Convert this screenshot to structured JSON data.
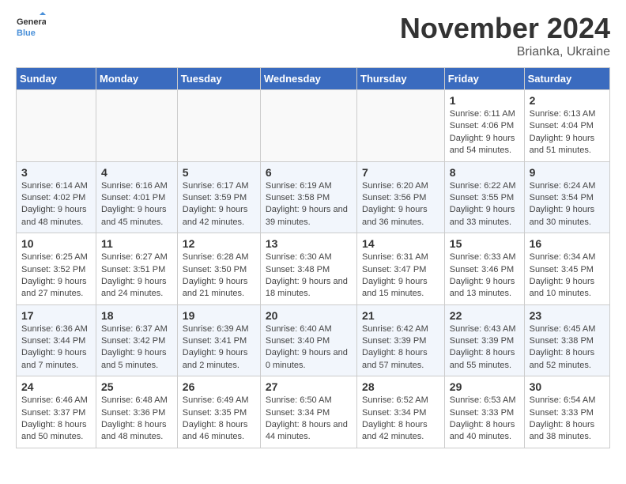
{
  "header": {
    "logo_line1": "General",
    "logo_line2": "Blue",
    "month": "November 2024",
    "location": "Brianka, Ukraine"
  },
  "weekdays": [
    "Sunday",
    "Monday",
    "Tuesday",
    "Wednesday",
    "Thursday",
    "Friday",
    "Saturday"
  ],
  "weeks": [
    [
      {
        "day": "",
        "info": ""
      },
      {
        "day": "",
        "info": ""
      },
      {
        "day": "",
        "info": ""
      },
      {
        "day": "",
        "info": ""
      },
      {
        "day": "",
        "info": ""
      },
      {
        "day": "1",
        "info": "Sunrise: 6:11 AM\nSunset: 4:06 PM\nDaylight: 9 hours and 54 minutes."
      },
      {
        "day": "2",
        "info": "Sunrise: 6:13 AM\nSunset: 4:04 PM\nDaylight: 9 hours and 51 minutes."
      }
    ],
    [
      {
        "day": "3",
        "info": "Sunrise: 6:14 AM\nSunset: 4:02 PM\nDaylight: 9 hours and 48 minutes."
      },
      {
        "day": "4",
        "info": "Sunrise: 6:16 AM\nSunset: 4:01 PM\nDaylight: 9 hours and 45 minutes."
      },
      {
        "day": "5",
        "info": "Sunrise: 6:17 AM\nSunset: 3:59 PM\nDaylight: 9 hours and 42 minutes."
      },
      {
        "day": "6",
        "info": "Sunrise: 6:19 AM\nSunset: 3:58 PM\nDaylight: 9 hours and 39 minutes."
      },
      {
        "day": "7",
        "info": "Sunrise: 6:20 AM\nSunset: 3:56 PM\nDaylight: 9 hours and 36 minutes."
      },
      {
        "day": "8",
        "info": "Sunrise: 6:22 AM\nSunset: 3:55 PM\nDaylight: 9 hours and 33 minutes."
      },
      {
        "day": "9",
        "info": "Sunrise: 6:24 AM\nSunset: 3:54 PM\nDaylight: 9 hours and 30 minutes."
      }
    ],
    [
      {
        "day": "10",
        "info": "Sunrise: 6:25 AM\nSunset: 3:52 PM\nDaylight: 9 hours and 27 minutes."
      },
      {
        "day": "11",
        "info": "Sunrise: 6:27 AM\nSunset: 3:51 PM\nDaylight: 9 hours and 24 minutes."
      },
      {
        "day": "12",
        "info": "Sunrise: 6:28 AM\nSunset: 3:50 PM\nDaylight: 9 hours and 21 minutes."
      },
      {
        "day": "13",
        "info": "Sunrise: 6:30 AM\nSunset: 3:48 PM\nDaylight: 9 hours and 18 minutes."
      },
      {
        "day": "14",
        "info": "Sunrise: 6:31 AM\nSunset: 3:47 PM\nDaylight: 9 hours and 15 minutes."
      },
      {
        "day": "15",
        "info": "Sunrise: 6:33 AM\nSunset: 3:46 PM\nDaylight: 9 hours and 13 minutes."
      },
      {
        "day": "16",
        "info": "Sunrise: 6:34 AM\nSunset: 3:45 PM\nDaylight: 9 hours and 10 minutes."
      }
    ],
    [
      {
        "day": "17",
        "info": "Sunrise: 6:36 AM\nSunset: 3:44 PM\nDaylight: 9 hours and 7 minutes."
      },
      {
        "day": "18",
        "info": "Sunrise: 6:37 AM\nSunset: 3:42 PM\nDaylight: 9 hours and 5 minutes."
      },
      {
        "day": "19",
        "info": "Sunrise: 6:39 AM\nSunset: 3:41 PM\nDaylight: 9 hours and 2 minutes."
      },
      {
        "day": "20",
        "info": "Sunrise: 6:40 AM\nSunset: 3:40 PM\nDaylight: 9 hours and 0 minutes."
      },
      {
        "day": "21",
        "info": "Sunrise: 6:42 AM\nSunset: 3:39 PM\nDaylight: 8 hours and 57 minutes."
      },
      {
        "day": "22",
        "info": "Sunrise: 6:43 AM\nSunset: 3:39 PM\nDaylight: 8 hours and 55 minutes."
      },
      {
        "day": "23",
        "info": "Sunrise: 6:45 AM\nSunset: 3:38 PM\nDaylight: 8 hours and 52 minutes."
      }
    ],
    [
      {
        "day": "24",
        "info": "Sunrise: 6:46 AM\nSunset: 3:37 PM\nDaylight: 8 hours and 50 minutes."
      },
      {
        "day": "25",
        "info": "Sunrise: 6:48 AM\nSunset: 3:36 PM\nDaylight: 8 hours and 48 minutes."
      },
      {
        "day": "26",
        "info": "Sunrise: 6:49 AM\nSunset: 3:35 PM\nDaylight: 8 hours and 46 minutes."
      },
      {
        "day": "27",
        "info": "Sunrise: 6:50 AM\nSunset: 3:34 PM\nDaylight: 8 hours and 44 minutes."
      },
      {
        "day": "28",
        "info": "Sunrise: 6:52 AM\nSunset: 3:34 PM\nDaylight: 8 hours and 42 minutes."
      },
      {
        "day": "29",
        "info": "Sunrise: 6:53 AM\nSunset: 3:33 PM\nDaylight: 8 hours and 40 minutes."
      },
      {
        "day": "30",
        "info": "Sunrise: 6:54 AM\nSunset: 3:33 PM\nDaylight: 8 hours and 38 minutes."
      }
    ]
  ]
}
